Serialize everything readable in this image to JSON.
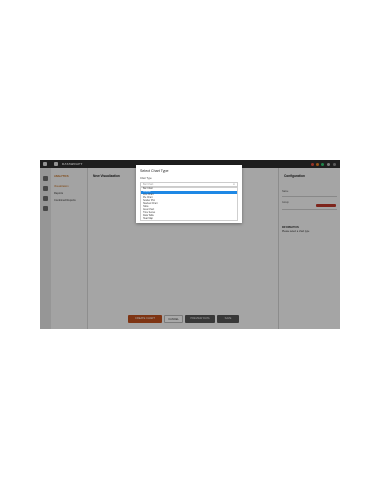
{
  "app": {
    "brand": "DATAWRAPT"
  },
  "sidebar": {
    "section": "ANALYTICS",
    "items": [
      {
        "label": "Visualization",
        "active": true
      },
      {
        "label": "Reports"
      },
      {
        "label": "Combined Reports"
      }
    ]
  },
  "main": {
    "title": "New Visualization"
  },
  "config": {
    "title": "Configuration",
    "labels": [
      "Name",
      "Group"
    ],
    "subtitle": "INFORMATION",
    "note": "Please select a chart type"
  },
  "actions": {
    "create": "CREATE CHART",
    "cancel": "CANCEL",
    "preview": "PREVIEW DATA",
    "save": "SAVE"
  },
  "modal": {
    "title": "Select Chart Type",
    "label": "Chart Type",
    "placeholder": "Bar Chart",
    "options": [
      "Bar Chart",
      "Column",
      "Line Chart",
      "Pie Chart",
      "Scatter Plot",
      "Stacked Chart",
      "Table",
      "Area Chart",
      "Time Series",
      "Data Table",
      "Heat Map"
    ],
    "selected_index": 1
  },
  "colors": {
    "accent": "#c0501e",
    "selection": "#1e88e5",
    "topbar": "#2e2e2e"
  }
}
